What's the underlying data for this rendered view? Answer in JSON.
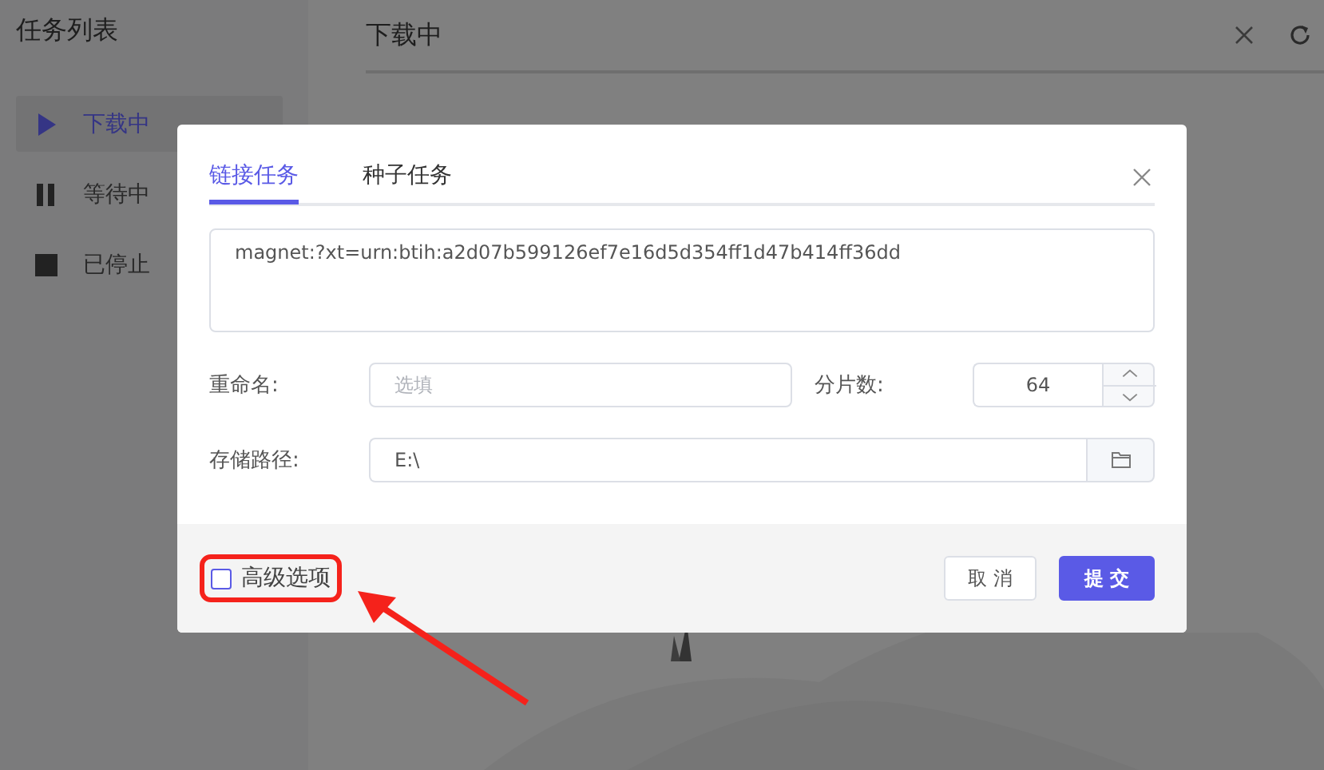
{
  "sidebar": {
    "title": "任务列表",
    "items": [
      {
        "label": "下载中",
        "kind": "play",
        "selected": true
      },
      {
        "label": "等待中",
        "kind": "pause",
        "selected": false
      },
      {
        "label": "已停止",
        "kind": "stop",
        "selected": false
      }
    ]
  },
  "main": {
    "title": "下载中"
  },
  "dialog": {
    "tabs": [
      {
        "label": "链接任务",
        "selected": true
      },
      {
        "label": "种子任务",
        "selected": false
      }
    ],
    "link_input": {
      "value": "magnet:?xt=urn:btih:a2d07b599126ef7e16d5d354ff1d47b414ff36dd"
    },
    "rename": {
      "label": "重命名:",
      "placeholder": "选填"
    },
    "segments": {
      "label": "分片数:",
      "value": "64"
    },
    "save_path": {
      "label": "存储路径:",
      "value": "E:\\"
    },
    "advanced": {
      "label": "高级选项",
      "checked": false
    },
    "buttons": [
      {
        "label": "取 消",
        "kind": "default"
      },
      {
        "label": "提 交",
        "kind": "primary"
      }
    ]
  }
}
